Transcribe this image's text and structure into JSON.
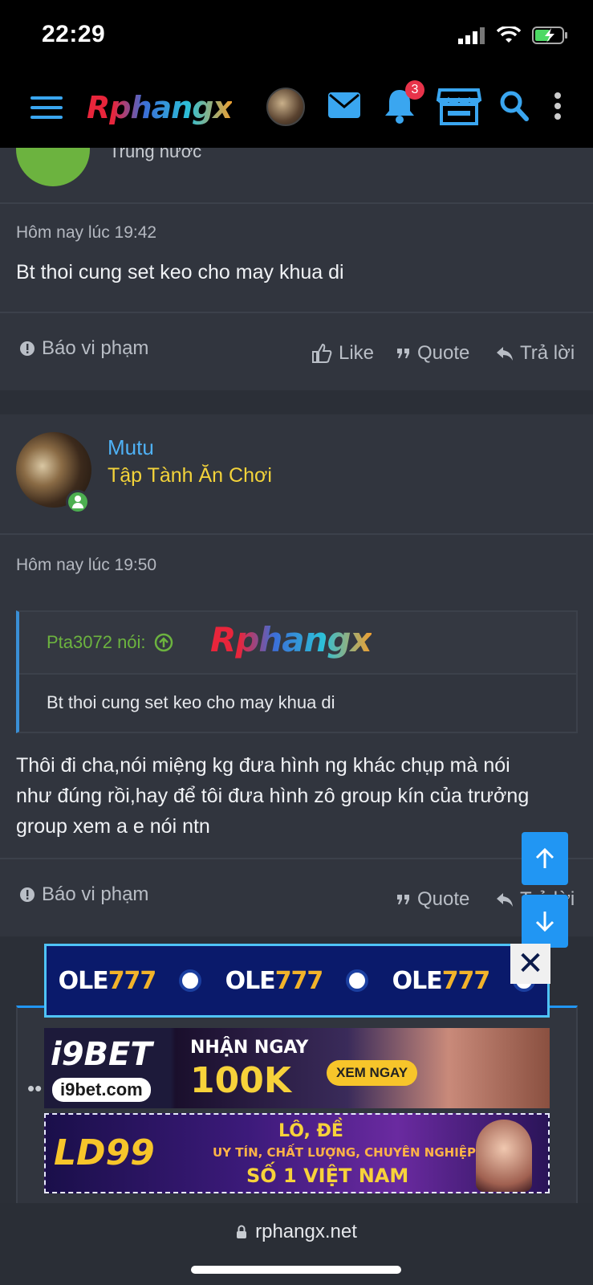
{
  "status_bar": {
    "time": "22:29"
  },
  "header": {
    "logo": "Rphangx",
    "notification_count": "3"
  },
  "posts": [
    {
      "fragment_text": "Trung nước",
      "timestamp": "Hôm nay lúc 19:42",
      "message": "Bt thoi cung set keo cho may khua di",
      "actions": {
        "report": "Báo vi phạm",
        "like": "Like",
        "quote": "Quote",
        "reply": "Trả lời"
      }
    },
    {
      "author": {
        "name": "Mutu",
        "title": "Tập Tành Ăn Chơi"
      },
      "timestamp": "Hôm nay lúc 19:50",
      "quote": {
        "author": "Pta3072 nói:",
        "logo": "Rphangx",
        "text": "Bt thoi cung set keo cho may khua di"
      },
      "message_lines": [
        "Thôi đi cha,nói miệng kg đưa hình ng khác chụp mà nói",
        "như đúng rồi,hay để tôi đưa hình zô group kín của trưởng",
        "group xem a e nói ntn"
      ],
      "actions": {
        "report": "Báo vi phạm",
        "quote": "Quote",
        "reply": "Trả lời"
      }
    }
  ],
  "ads": {
    "ole": {
      "brand_a": "OLE",
      "brand_b": "777",
      "close": "✕"
    },
    "i9bet": {
      "logo": "i9BET",
      "site": "i9bet.com",
      "line1": "NHẬN NGAY",
      "line2": "100K",
      "button": "XEM NGAY"
    },
    "ld": {
      "logo": "LD99",
      "line1": "LÔ, ĐỀ",
      "line2": "UY TÍN, CHẤT LƯỢNG, CHUYÊN NGHIỆP",
      "line3": "SỐ 1 VIỆT NAM"
    }
  },
  "browser": {
    "url": "rphangx.net"
  },
  "colors": {
    "accent": "#2196f3",
    "username": "#4fb1f5",
    "user_title": "#f3d33a",
    "quote_author": "#6cb33f"
  }
}
